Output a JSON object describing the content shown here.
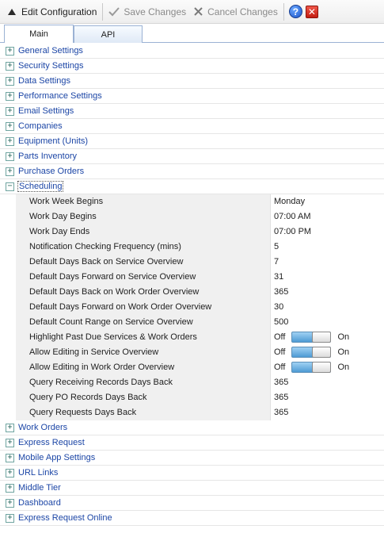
{
  "toolbar": {
    "edit_config": "Edit Configuration",
    "save": "Save Changes",
    "cancel": "Cancel Changes",
    "help_glyph": "?",
    "close_glyph": "✕"
  },
  "tabs": [
    {
      "label": "Main",
      "active": true
    },
    {
      "label": "API",
      "active": false
    }
  ],
  "sections_before": [
    "General Settings",
    "Security Settings",
    "Data Settings",
    "Performance Settings",
    "Email Settings",
    "Companies",
    "Equipment (Units)",
    "Parts Inventory",
    "Purchase Orders"
  ],
  "expanded_section": {
    "label": "Scheduling",
    "properties": [
      {
        "name": "Work Week Begins",
        "value": "Monday"
      },
      {
        "name": "Work Day Begins",
        "value": "07:00 AM"
      },
      {
        "name": "Work Day Ends",
        "value": "07:00 PM"
      },
      {
        "name": "Notification Checking Frequency (mins)",
        "value": "5"
      },
      {
        "name": "Default Days Back on Service Overview",
        "value": "7"
      },
      {
        "name": "Default Days Forward on Service Overview",
        "value": "31"
      },
      {
        "name": "Default Days Back on Work Order Overview",
        "value": "365"
      },
      {
        "name": "Default Days Forward on Work Order Overview",
        "value": "30"
      },
      {
        "name": "Default Count Range on Service Overview",
        "value": "500"
      },
      {
        "name": "Highlight Past Due Services & Work Orders",
        "toggle": true,
        "off": "Off",
        "on": "On",
        "state": 1
      },
      {
        "name": "Allow Editing in Service Overview",
        "toggle": true,
        "off": "Off",
        "on": "On",
        "state": 1
      },
      {
        "name": "Allow Editing in Work Order Overview",
        "toggle": true,
        "off": "Off",
        "on": "On",
        "state": 1
      },
      {
        "name": "Query Receiving Records Days Back",
        "value": "365"
      },
      {
        "name": "Query PO Records Days Back",
        "value": "365"
      },
      {
        "name": "Query Requests Days Back",
        "value": "365"
      }
    ]
  },
  "sections_after": [
    "Work Orders",
    "Express Request",
    "Mobile App Settings",
    "URL Links",
    "Middle Tier",
    "Dashboard",
    "Express Request Online"
  ],
  "colors": {
    "section_text": "#1c46a6",
    "property_bg": "#f0f0f0",
    "toggle_fill": "#4e9bd4"
  },
  "icons": {
    "edit": "triangle-up-icon",
    "save": "checkmark-icon",
    "cancel": "x-icon",
    "help": "help-icon",
    "close": "close-icon",
    "expand": "plus-icon",
    "collapse": "minus-icon"
  }
}
